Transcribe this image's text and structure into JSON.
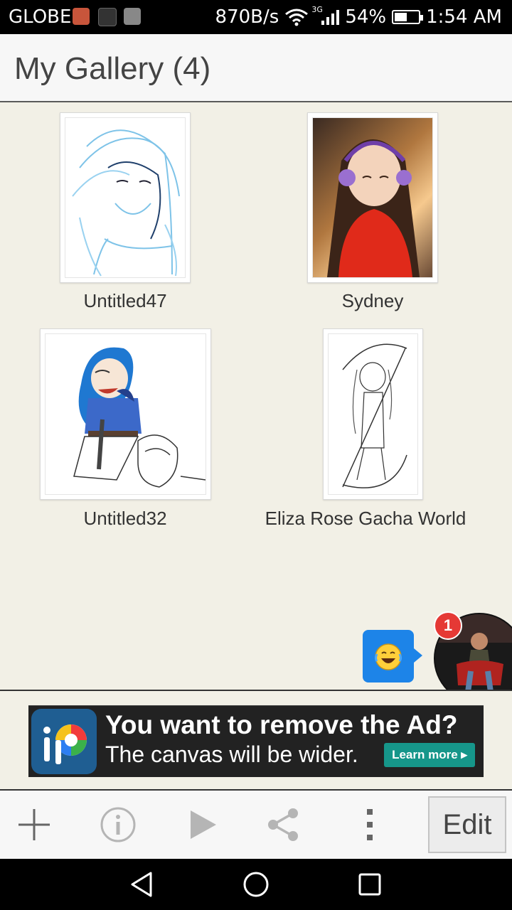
{
  "status_bar": {
    "carrier": "GLOBE",
    "network_speed": "870B/s",
    "network_type": "3G",
    "battery": "54%",
    "battery_level": 0.54,
    "time": "1:54 AM"
  },
  "header": {
    "title": "My Gallery (4)"
  },
  "gallery": {
    "items": [
      {
        "name": "Untitled47"
      },
      {
        "name": "Sydney"
      },
      {
        "name": "Untitled32"
      },
      {
        "name": "Eliza Rose Gacha World"
      }
    ]
  },
  "floating": {
    "notification_count": "1"
  },
  "ad": {
    "headline": "You want to remove the Ad?",
    "subtext": "The canvas will be wider.",
    "cta": "Learn more ▸"
  },
  "toolbar": {
    "icons": [
      "add-icon",
      "info-icon",
      "play-icon",
      "share-icon",
      "more-icon"
    ],
    "edit_label": "Edit"
  },
  "colors": {
    "gallery_bg": "#f2f0e6",
    "header_bg": "#f7f7f7",
    "ad_cta": "#16968a",
    "chat_bubble": "#1d84e8",
    "badge": "#e53935"
  }
}
